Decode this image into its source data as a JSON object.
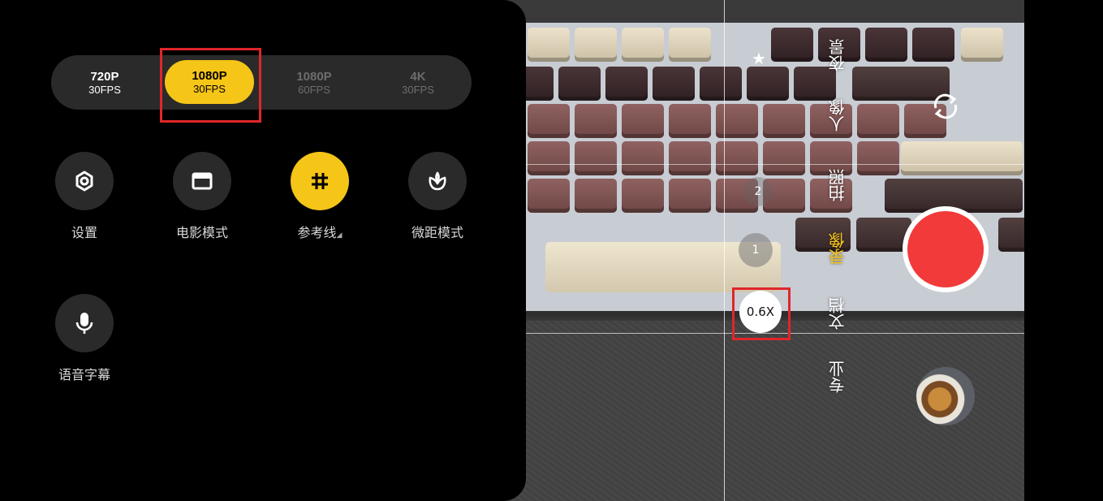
{
  "resolution_options": [
    {
      "line1": "720P",
      "line2": "30FPS",
      "state": "normal"
    },
    {
      "line1": "1080P",
      "line2": "30FPS",
      "state": "selected"
    },
    {
      "line1": "1080P",
      "line2": "60FPS",
      "state": "dim"
    },
    {
      "line1": "4K",
      "line2": "30FPS",
      "state": "dim"
    }
  ],
  "tools": {
    "settings": {
      "label": "设置",
      "icon": "gear-icon"
    },
    "movie_mode": {
      "label": "电影模式",
      "icon": "film-frame-icon"
    },
    "grid_lines": {
      "label": "参考线",
      "icon": "grid-hash-icon",
      "active": true
    },
    "macro_mode": {
      "label": "微距模式",
      "icon": "flower-macro-icon"
    },
    "voice_caption": {
      "label": "语音字幕",
      "icon": "microphone-icon"
    }
  },
  "camera": {
    "modes": [
      "夜景",
      "人像",
      "拍照",
      "录像",
      "文档",
      "专业"
    ],
    "active_mode": "录像",
    "zoom_levels": {
      "ultra_wide": "0.6X",
      "main": "1",
      "tele": "2"
    }
  },
  "colors": {
    "accent": "#f5c518",
    "record": "#f23a3a",
    "highlight_box": "#e0262a",
    "panel_bg": "#000000"
  }
}
